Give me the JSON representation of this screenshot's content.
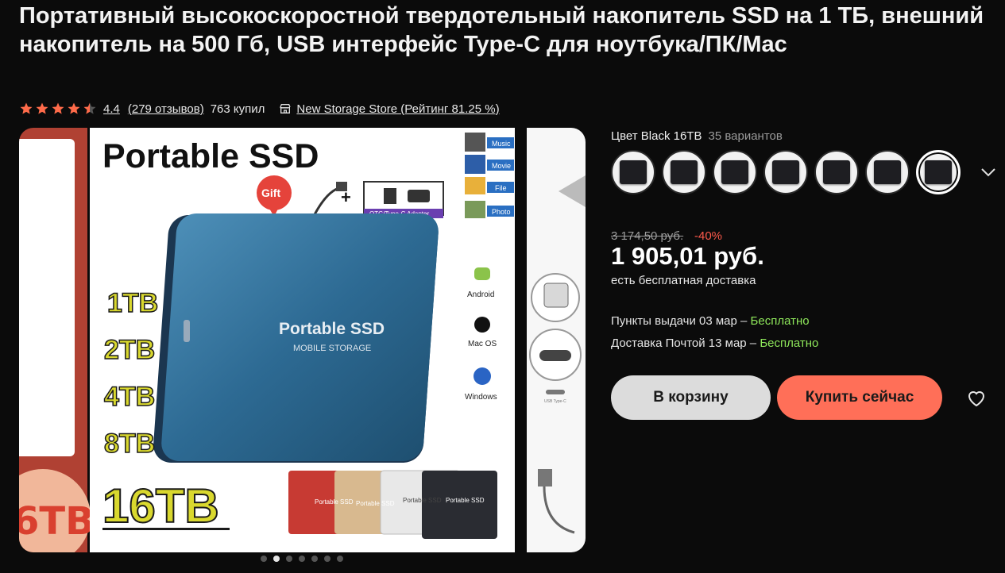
{
  "product": {
    "title": "Портативный высокоскоростной твердотельный накопитель SSD на 1 ТБ, внешний накопитель на 500 Гб, USB интерфейс Type-C для ноутбука/ПК/Mac",
    "rating": "4.4",
    "rating_value": 4.4,
    "reviews": "(279 отзывов)",
    "bought": "763 купил",
    "store": "New Storage Store (Рейтинг 81.25 %)",
    "store_icon": "store-icon",
    "star_icon": "star-icon"
  },
  "gallery": {
    "main_image": {
      "headline": "Portable SSD",
      "gift": "Gift",
      "adapter": "OTG/Type-C Adapter",
      "media": [
        "Music",
        "Movie",
        "File",
        "Photo"
      ],
      "device_label": "Portable SSD",
      "device_sub": "MOBILE STORAGE",
      "capacities": [
        "1TB",
        "2TB",
        "4TB",
        "8TB"
      ],
      "big_capacity": "16TB",
      "os": [
        "Android",
        "Mac OS",
        "Windows"
      ],
      "color_variants_label": "Portable SSD"
    },
    "left_caption": "6TB",
    "right_caption": "USB Type-C",
    "dots_count": 7,
    "active_dot": 1
  },
  "options": {
    "color_label": "Цвет Black 16TB",
    "variants": "35 вариантов",
    "swatch_count": 7,
    "selected_index": 6,
    "expand_icon": "chevron-down-icon"
  },
  "pricing": {
    "old_price": "3 174,50 руб.",
    "discount": "-40%",
    "price": "1 905,01 руб.",
    "shipping_note": "есть бесплатная доставка",
    "pickup": "Пункты выдачи 03 мар – ",
    "pickup_free": "Бесплатно",
    "post": "Доставка Почтой 13 мар – ",
    "post_free": "Бесплатно"
  },
  "actions": {
    "cart": "В корзину",
    "buy": "Купить сейчас",
    "wishlist_icon": "heart-icon"
  },
  "colors": {
    "background": "#0b0b0b",
    "accent": "#ff6f58",
    "discount": "#ff5a4b",
    "free": "#8fe85b",
    "star": "#ff6b4a"
  }
}
